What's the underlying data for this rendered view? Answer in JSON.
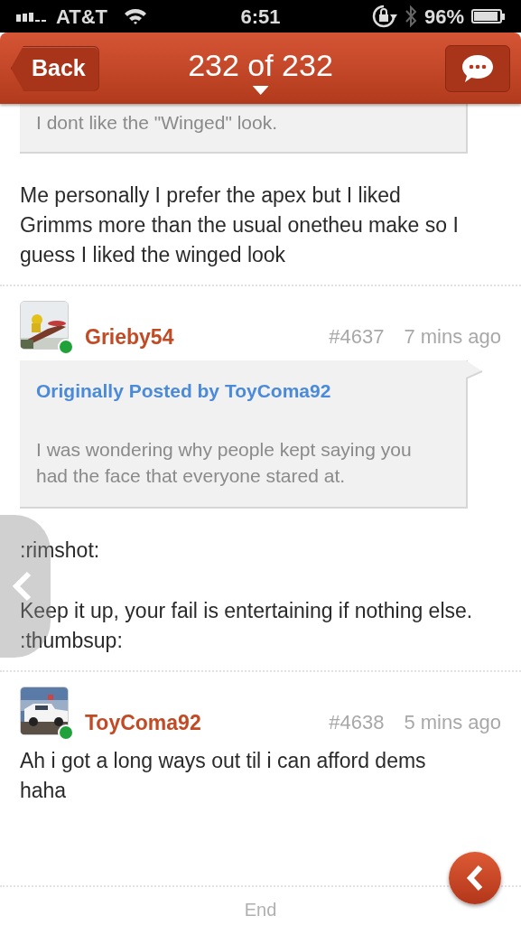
{
  "status_bar": {
    "carrier": "AT&T",
    "time": "6:51",
    "battery": "96%"
  },
  "nav": {
    "back": "Back",
    "title": "232 of 232"
  },
  "posts": [
    {
      "kind": "continued",
      "quote": {
        "text": "I dont like the \"Winged\" look."
      },
      "body": [
        "Me personally I prefer the apex but I liked Grimms more than the usual onetheu make so I guess I liked the winged look"
      ]
    },
    {
      "kind": "full",
      "author": "Grieby54",
      "online": true,
      "number": "#4637",
      "time": "7 mins ago",
      "quote": {
        "heading": "Originally Posted by ToyComa92",
        "text": "I was wondering why people kept saying you had the face that everyone stared at."
      },
      "body": [
        ":rimshot:",
        "Keep it up, your fail is entertaining if nothing else. :thumbsup:"
      ]
    },
    {
      "kind": "full",
      "author": "ToyComa92",
      "online": true,
      "number": "#4638",
      "time": "5 mins ago",
      "body": [
        "Ah i got a long ways out til i can afford dems haha"
      ]
    }
  ],
  "footer": "End"
}
